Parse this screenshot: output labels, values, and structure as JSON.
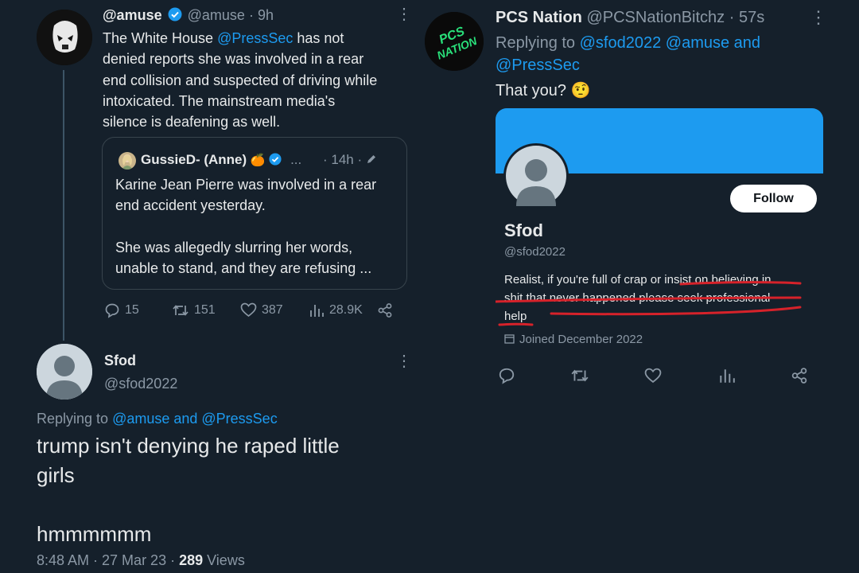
{
  "left_thread": {
    "tweet1": {
      "display_name": "@amuse",
      "handle": "@amuse",
      "time": "· 9h",
      "text_parts": {
        "l1_a": "The White House ",
        "l1_mention": "@PressSec",
        "l1_b": " has not",
        "l2": "denied reports she was involved in a rear",
        "l3": "end collision and suspected of driving while",
        "l4": "intoxicated. The mainstream media's",
        "l5": "silence is deafening as well."
      },
      "quote": {
        "display_name": "GussieD- (Anne)",
        "emoji": "🍊",
        "ellipsis": "...",
        "time": "· 14h ·",
        "l1": "Karine Jean Pierre was involved in a rear",
        "l2": "end accident yesterday.",
        "l3": "She was allegedly slurring her words,",
        "l4": "unable to stand, and they are refusing ..."
      },
      "actions": {
        "replies": "15",
        "retweets": "151",
        "likes": "387",
        "views": "28.9K"
      }
    },
    "tweet2": {
      "display_name": "Sfod",
      "handle": "@sfod2022",
      "replying_prefix": "Replying to ",
      "replying_to": "@amuse and @PressSec",
      "text_l1": "trump isn't denying he raped little",
      "text_l2": "girls",
      "text_l3": "hmmmmmm",
      "time": "8:48 AM · 27 Mar 23 · ",
      "views_count": "289",
      "views_label": " Views"
    }
  },
  "right_tweet": {
    "display_name": "PCS Nation",
    "handle": "@PCSNationBitchz · 57s",
    "avatar_text_l1": "PCS",
    "avatar_text_l2": "NATION",
    "replying_prefix": "Replying to ",
    "replying_l1": "@sfod2022 @amuse and",
    "replying_l2": "@PressSec",
    "text": "That you?",
    "emoji": "🤨",
    "profile": {
      "follow_label": "Follow",
      "name": "Sfod",
      "handle": "@sfod2022",
      "bio_l1": "Realist, if you're full of crap or insist on believing in",
      "bio_l2": "shit that never happened please seek professional",
      "bio_l3": "help",
      "joined": "Joined December 2022"
    }
  },
  "colors": {
    "background": "#15202b",
    "accent": "#1d9bf0",
    "annotation": "#d6222a"
  }
}
